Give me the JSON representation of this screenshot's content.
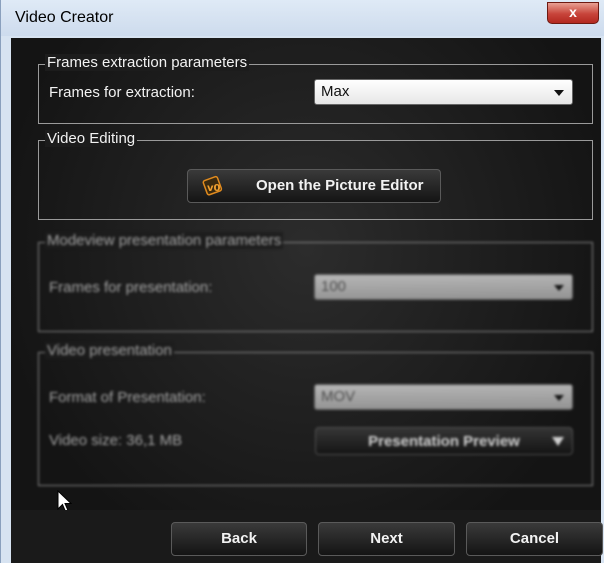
{
  "window": {
    "title": "Video Creator",
    "close_label": "x"
  },
  "frames_extraction": {
    "legend": "Frames extraction parameters",
    "label": "Frames for extraction:",
    "value": "Max"
  },
  "video_editing": {
    "legend": "Video Editing",
    "button_label": "Open the Picture Editor"
  },
  "modeview": {
    "legend": "Modeview presentation parameters",
    "label": "Frames for presentation:",
    "value": "100"
  },
  "video_presentation": {
    "legend": "Video presentation",
    "format_label": "Format of Presentation:",
    "format_value": "MOV",
    "size_label": "Video size: 36,1 MB",
    "preview_label": "Presentation Preview"
  },
  "footer": {
    "back_label": "Back",
    "next_label": "Next",
    "cancel_label": "Cancel"
  }
}
